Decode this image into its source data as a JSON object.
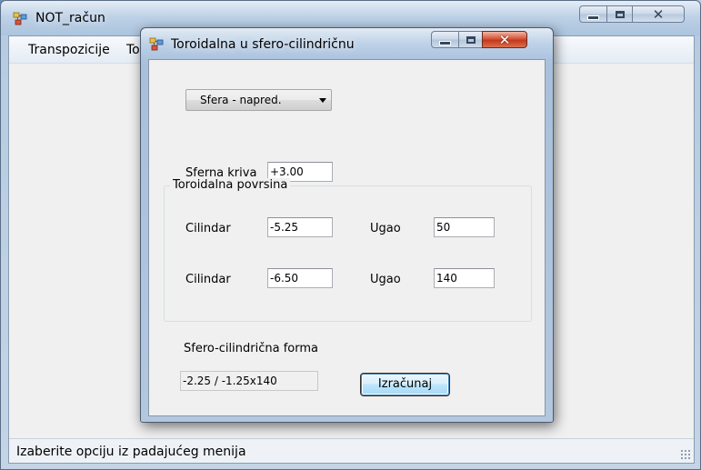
{
  "main_window": {
    "title": "NOT_račun",
    "app_icon": "windows-forms-icon",
    "menu": [
      {
        "label": "Transpozicije"
      },
      {
        "label": "To"
      }
    ],
    "status": "Izaberite opciju iz padajućeg menija"
  },
  "dialog": {
    "title": "Toroidalna u sfero-cilindričnu",
    "app_icon": "windows-forms-icon",
    "combo": {
      "value": "Sfera - napred."
    },
    "sphere": {
      "label": "Sferna kriva",
      "value": "+3.00"
    },
    "group": {
      "title": "Toroidalna povrsina",
      "rows": [
        {
          "cyl_label": "Cilindar",
          "cyl_value": "-5.25",
          "axis_label": "Ugao",
          "axis_value": "50"
        },
        {
          "cyl_label": "Cilindar",
          "cyl_value": "-6.50",
          "axis_label": "Ugao",
          "axis_value": "140"
        }
      ]
    },
    "result": {
      "label": "Sfero-cilindrična forma",
      "value": "-2.25 / -1.25x140"
    },
    "calc_button": "Izračunaj"
  },
  "caption_glyphs": {
    "close": "✕"
  }
}
